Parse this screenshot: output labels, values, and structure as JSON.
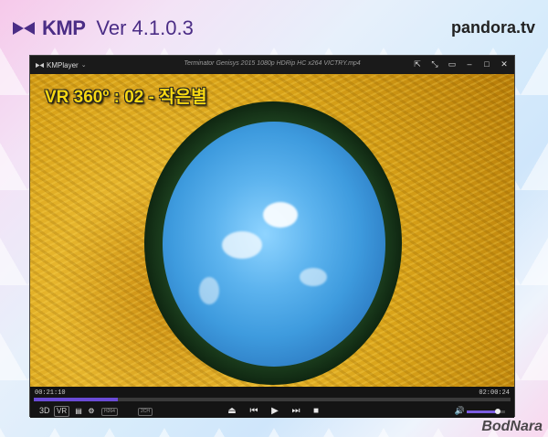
{
  "header": {
    "brand": "KMP",
    "version": "Ver 4.1.0.3",
    "site": "pandora.tv"
  },
  "watermark": "BodNara",
  "player": {
    "app_name": "KMPlayer",
    "file_title": "Terminator Genisys 2015 1080p HDRip HC x264 VICTRY.mp4",
    "overlay_text": "VR 360º : 02 - 작은별",
    "time_current": "00:21:10",
    "time_total": "02:00:24",
    "progress": 0.176,
    "volume": 0.8,
    "tags": {
      "codec": "H264",
      "channels": "2CH"
    },
    "buttons": {
      "three_d": "3D",
      "vr": "VR"
    }
  },
  "colors": {
    "brand": "#4b2d86",
    "accent": "#6a4bd6",
    "overlay_text": "#f7d812"
  }
}
